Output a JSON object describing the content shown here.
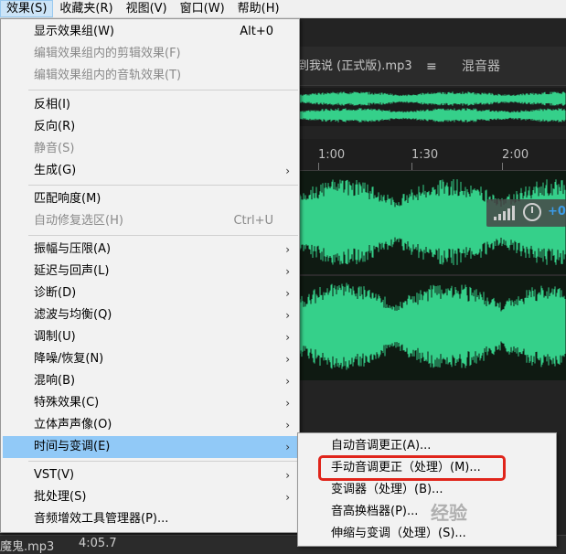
{
  "menubar": {
    "items": [
      {
        "label": "效果(S)",
        "active": true
      },
      {
        "label": "收藏夹(R)",
        "active": false
      },
      {
        "label": "视图(V)",
        "active": false
      },
      {
        "label": "窗口(W)",
        "active": false
      },
      {
        "label": "帮助(H)",
        "active": false
      }
    ]
  },
  "editor": {
    "tab_file": "到我说 (正式版).mp3",
    "tab_menu_icon": "≡",
    "tab_mixer": "混音器",
    "ruler": [
      "1:00",
      "1:30",
      "2:00"
    ],
    "gain_value": "+0",
    "bottom_file": "魔鬼.mp3",
    "bottom_time": "4:05.7",
    "waveform_color": "#35d08a"
  },
  "effects_menu": {
    "items": [
      {
        "label": "显示效果组(W)",
        "shortcut": "Alt+0",
        "disabled": false,
        "submenu": false
      },
      {
        "label": "编辑效果组内的剪辑效果(F)",
        "shortcut": "",
        "disabled": true,
        "submenu": false
      },
      {
        "label": "编辑效果组内的音轨效果(T)",
        "shortcut": "",
        "disabled": true,
        "submenu": false
      },
      {
        "label": "反相(I)",
        "shortcut": "",
        "disabled": false,
        "submenu": false
      },
      {
        "label": "反向(R)",
        "shortcut": "",
        "disabled": false,
        "submenu": false
      },
      {
        "label": "静音(S)",
        "shortcut": "",
        "disabled": true,
        "submenu": false
      },
      {
        "label": "生成(G)",
        "shortcut": "",
        "disabled": false,
        "submenu": true
      },
      {
        "label": "匹配响度(M)",
        "shortcut": "",
        "disabled": false,
        "submenu": false
      },
      {
        "label": "自动修复选区(H)",
        "shortcut": "Ctrl+U",
        "disabled": true,
        "submenu": false
      },
      {
        "label": "振幅与压限(A)",
        "shortcut": "",
        "disabled": false,
        "submenu": true
      },
      {
        "label": "延迟与回声(L)",
        "shortcut": "",
        "disabled": false,
        "submenu": true
      },
      {
        "label": "诊断(D)",
        "shortcut": "",
        "disabled": false,
        "submenu": true
      },
      {
        "label": "滤波与均衡(Q)",
        "shortcut": "",
        "disabled": false,
        "submenu": true
      },
      {
        "label": "调制(U)",
        "shortcut": "",
        "disabled": false,
        "submenu": true
      },
      {
        "label": "降噪/恢复(N)",
        "shortcut": "",
        "disabled": false,
        "submenu": true
      },
      {
        "label": "混响(B)",
        "shortcut": "",
        "disabled": false,
        "submenu": true
      },
      {
        "label": "特殊效果(C)",
        "shortcut": "",
        "disabled": false,
        "submenu": true
      },
      {
        "label": "立体声声像(O)",
        "shortcut": "",
        "disabled": false,
        "submenu": true
      },
      {
        "label": "时间与变调(E)",
        "shortcut": "",
        "disabled": false,
        "submenu": true,
        "highlighted": true
      },
      {
        "label": "VST(V)",
        "shortcut": "",
        "disabled": false,
        "submenu": true
      },
      {
        "label": "批处理(S)",
        "shortcut": "",
        "disabled": false,
        "submenu": true
      },
      {
        "label": "音频增效工具管理器(P)...",
        "shortcut": "",
        "disabled": false,
        "submenu": false
      }
    ]
  },
  "submenu": {
    "items": [
      {
        "label": "自动音调更正(A)..."
      },
      {
        "label": "手动音调更正（处理）(M)..."
      },
      {
        "label": "变调器（处理）(B)..."
      },
      {
        "label": "音高换档器(P)..."
      },
      {
        "label": "伸缩与变调（处理）(S)..."
      }
    ]
  },
  "watermark": "经验"
}
